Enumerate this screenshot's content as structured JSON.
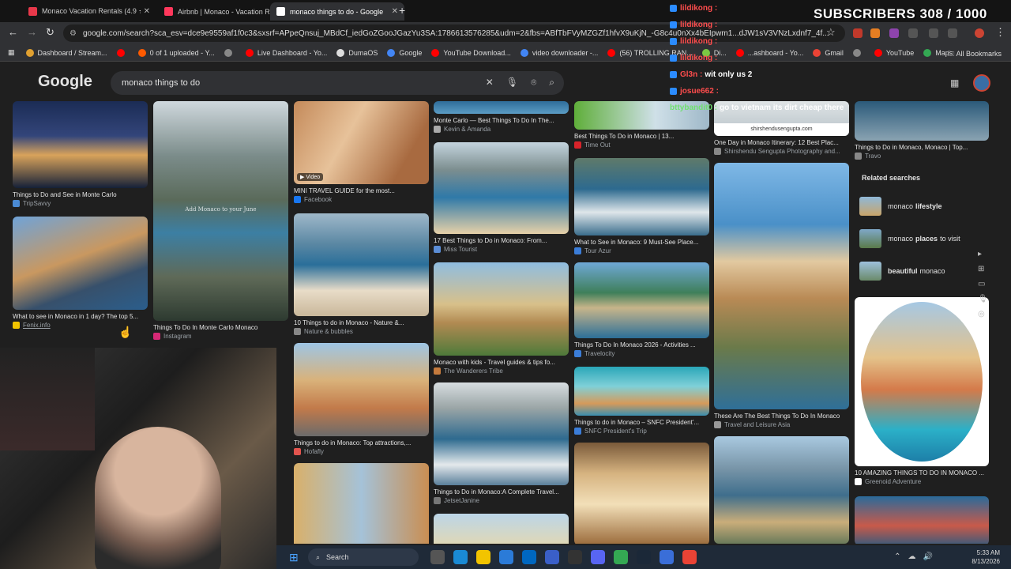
{
  "tabs": [
    {
      "label": "Monaco Vacation Rentals (4.9 ★",
      "color": "#e8384a",
      "active": false
    },
    {
      "label": "Airbnb | Monaco - Vacation Re",
      "color": "#ff385c",
      "active": false
    },
    {
      "label": "monaco things to do - Google",
      "color": "#ffffff",
      "active": true
    }
  ],
  "toolbar": {
    "url": "google.com/search?sca_esv=dce9e9559af1f0c3&sxsrf=APpeQnsuj_MBdCf_iedGoZGooJGazYu3SA:1786613576285&udm=2&fbs=ABfTbFVyMZGZf1hfvX9uKjN_-G8c4u0nXx4bEIpwm1...dJW1sV3VNzLxdnf7_4f..."
  },
  "bookmarks": [
    {
      "label": "Dashboard / Stream...",
      "color": "#e0a030"
    },
    {
      "label": "",
      "color": "#ff0000"
    },
    {
      "label": "0 of 1 uploaded - Y...",
      "color": "#ff5a00"
    },
    {
      "label": "",
      "color": "#888888"
    },
    {
      "label": "Live Dashboard - Yo...",
      "color": "#ff0000"
    },
    {
      "label": "DumaOS",
      "color": "#dddddd"
    },
    {
      "label": "Google",
      "color": "#4285f4"
    },
    {
      "label": "YouTube Download...",
      "color": "#ff0000"
    },
    {
      "label": "video downloader -...",
      "color": "#4285f4"
    },
    {
      "label": "(56) TROLLING RAN...",
      "color": "#ff0000"
    },
    {
      "label": "Di...",
      "color": "#7ac943"
    },
    {
      "label": "...ashboard - Yo...",
      "color": "#ff0000"
    },
    {
      "label": "Gmail",
      "color": "#ea4335"
    },
    {
      "label": "",
      "color": "#888888"
    },
    {
      "label": "YouTube",
      "color": "#ff0000"
    },
    {
      "label": "Maps",
      "color": "#34a853"
    }
  ],
  "all_bookmarks": "All Bookmarks",
  "google": {
    "logo": "Google",
    "query": "monaco things to do"
  },
  "chat": [
    {
      "user": "lildikong :",
      "text": ""
    },
    {
      "user": "lildikong :",
      "text": ""
    },
    {
      "user": "lildikong :",
      "text": ""
    },
    {
      "user": "lildikong :",
      "text": ""
    },
    {
      "user": "Gl3n :",
      "text": "wit only us 2"
    },
    {
      "user": "josue662 :",
      "text": ""
    },
    {
      "user": "bttybandit0 :",
      "text": "go to vietnam its dirt cheap there"
    }
  ],
  "subscribers": "SUBSCRIBERS 308 / 1000",
  "results": [
    {
      "title": "Things to Do and See in Monte Carlo",
      "source": "TripSavvy",
      "src_color": "#4a8ad4",
      "col": 0,
      "row": 0
    },
    {
      "title": "What to see in Monaco in 1 day? The top 5...",
      "source": "Fenix.info",
      "src_color": "#f2c400",
      "col": 0,
      "row": 1
    },
    {
      "title": "Things To Do In Monte Carlo Monaco",
      "source": "Instagram",
      "src_color": "#d62976",
      "col": 1,
      "row": 0,
      "overlay": "Add Monaco to your June"
    },
    {
      "title": "MINI TRAVEL GUIDE for the most...",
      "source": "Facebook",
      "src_color": "#1877f2",
      "col": 2,
      "row": 0,
      "video": "▶ Video"
    },
    {
      "title": "10 Things to do in Monaco - Nature &...",
      "source": "Nature & bubbles",
      "src_color": "#888888",
      "col": 2,
      "row": 1
    },
    {
      "title": "Things to do in Monaco: Top attractions,...",
      "source": "Hofafly",
      "src_color": "#e2544e",
      "col": 2,
      "row": 2
    },
    {
      "title": "Monte Carlo — Best Things To Do In The...",
      "source": "Kevin & Amanda",
      "src_color": "#aaaaaa",
      "col": 3,
      "row": 0
    },
    {
      "title": "17 Best Things to Do in Monaco: From...",
      "source": "Miss Tourist",
      "src_color": "#5b8dd6",
      "col": 3,
      "row": 1
    },
    {
      "title": "Monaco with kids - Travel guides & tips fo...",
      "source": "The Wanderers Tribe",
      "src_color": "#c47a3d",
      "col": 3,
      "row": 2
    },
    {
      "title": "Things to Do in Monaco:A Complete Travel...",
      "source": "JetsetJanine",
      "src_color": "#777777",
      "col": 3,
      "row": 3
    },
    {
      "title": "Best Things To Do in Monaco | 13...",
      "source": "Time Out",
      "src_color": "#d8232a",
      "col": 4,
      "row": 0
    },
    {
      "title": "What to See in Monaco: 9 Must-See Place...",
      "source": "Tour Azur",
      "src_color": "#3b7dd8",
      "col": 4,
      "row": 1
    },
    {
      "title": "Things To Do In Monaco 2026 - Activities ...",
      "source": "Travelocity",
      "src_color": "#3b7dd8",
      "col": 4,
      "row": 2
    },
    {
      "title": "Things to do in Monaco – SNFC President'...",
      "source": "SNFC President's Trip",
      "src_color": "#3b7dd8",
      "col": 4,
      "row": 3
    },
    {
      "title": "One Day in Monaco Itinerary: 12 Best Plac...",
      "source": "Shirshendu Sengupta Photography and...",
      "src_color": "#888888",
      "col": 5,
      "row": 0,
      "banner": "shirshendusengupta.com"
    },
    {
      "title": "These Are The Best Things To Do In Monaco",
      "source": "Travel and Leisure Asia",
      "src_color": "#999999",
      "col": 5,
      "row": 1
    },
    {
      "title": "Things to Do in Monaco, Monaco | Top...",
      "source": "Travo",
      "src_color": "#888888",
      "col": 6,
      "row": 0
    },
    {
      "title": "10 AMAZING THINGS TO DO IN MONACO ...",
      "source": "Greenoid Adventure",
      "src_color": "#ffffff",
      "col": 6,
      "row": 1
    }
  ],
  "related": {
    "heading": "Related searches",
    "items": [
      {
        "prefix": "monaco",
        "bold": "lifestyle",
        "suffix": ""
      },
      {
        "prefix": "monaco",
        "bold": "places",
        "suffix": "to visit"
      },
      {
        "prefix": "",
        "bold": "beautiful",
        "suffix": "monaco"
      }
    ]
  },
  "taskbar": {
    "search": "Search",
    "time": "5:33 AM",
    "date": "8/13/2026"
  }
}
